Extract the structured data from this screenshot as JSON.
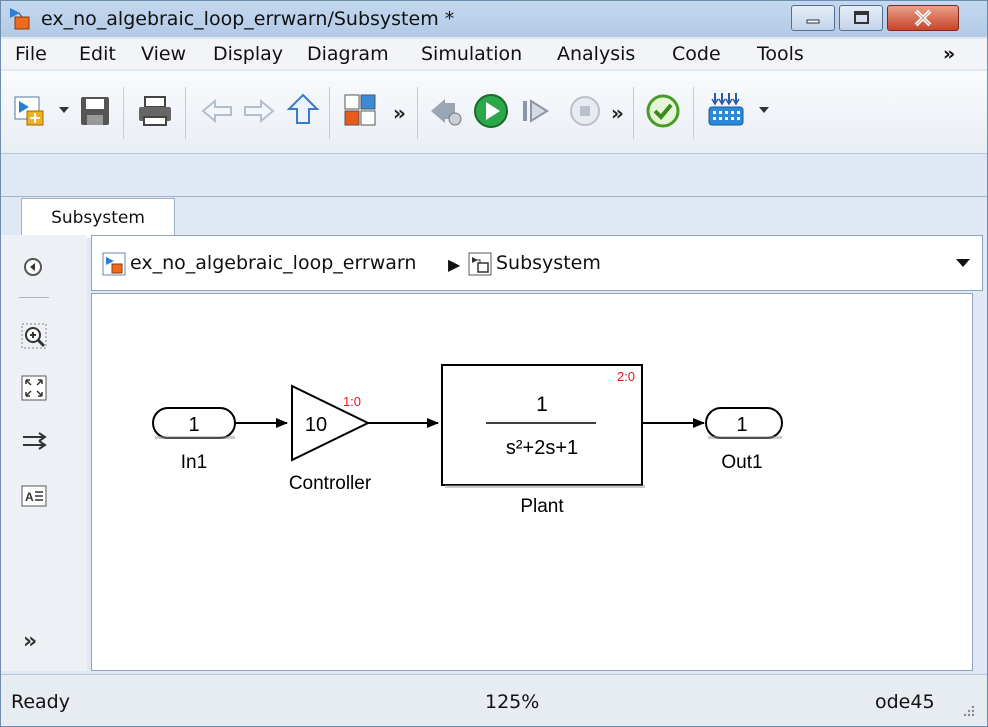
{
  "window": {
    "title": "ex_no_algebraic_loop_errwarn/Subsystem *"
  },
  "menu": [
    "File",
    "Edit",
    "View",
    "Display",
    "Diagram",
    "Simulation",
    "Analysis",
    "Code",
    "Tools",
    "»"
  ],
  "toolbar": {
    "more1": "»",
    "more2": "»",
    "more3": "»"
  },
  "tab": {
    "label": "Subsystem"
  },
  "breadcrumb": {
    "model": "ex_no_algebraic_loop_errwarn",
    "separator": "▶",
    "subsystem": "Subsystem"
  },
  "palette": {
    "more": "»"
  },
  "diagram": {
    "in1": {
      "port": "1",
      "name": "In1"
    },
    "controller": {
      "gain": "10",
      "name": "Controller",
      "tag": "1:0"
    },
    "plant": {
      "numerator": "1",
      "denominator": "s²+2s+1",
      "name": "Plant",
      "tag": "2:0"
    },
    "out1": {
      "port": "1",
      "name": "Out1"
    }
  },
  "status": {
    "state": "Ready",
    "zoom": "125%",
    "solver": "ode45"
  },
  "colors": {
    "sample_time_tag": "#e8141b",
    "window_border": "#6e8cab",
    "close_button": "#c9442a"
  }
}
